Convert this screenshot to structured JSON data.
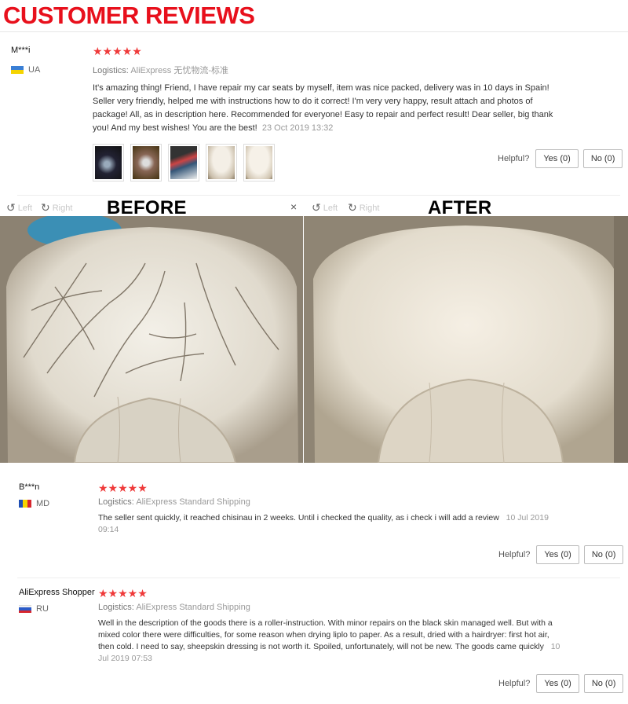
{
  "header": {
    "title": "CUSTOMER REVIEWS"
  },
  "colors": {
    "title": "#e8101c",
    "stars": "#ef3a3a"
  },
  "common": {
    "stars": "★★★★★",
    "helpful_label": "Helpful?",
    "logistics_label": "Logistics:"
  },
  "reviews": [
    {
      "user": "M***i",
      "country": "UA",
      "logistics": "AliExpress 无忧物流-标准",
      "text": "It's amazing thing! Friend, I have repair my car seats by myself, item was nice packed, delivery was in 10 days in Spain! Seller very friendly, helped me with instructions how to do it correct! I'm very very happy, result attach and photos of package! All, as in description here. Recommended for everyone! Easy to repair and perfect result! Dear seller, big thank you! And my best wishes! You are the best!",
      "date": "23 Oct 2019 13:32",
      "yes": "Yes (0)",
      "no": "No (0)"
    },
    {
      "user": "B***n",
      "country": "MD",
      "logistics": "AliExpress Standard Shipping",
      "text": "The seller sent quickly, it reached chisinau in 2 weeks. Until i checked the quality, as i check i will add a review",
      "date": "10 Jul 2019 09:14",
      "yes": "Yes (0)",
      "no": "No (0)"
    },
    {
      "user": "AliExpress Shopper",
      "country": "RU",
      "logistics": "AliExpress Standard Shipping",
      "text": "Well in the description of the goods there is a roller-instruction. With minor repairs on the black skin managed well. But with a mixed color there were difficulties, for some reason when drying liplo to paper. As a result, dried with a hairdryer: first hot air, then cold. I need to say, sheepskin dressing is not worth it. Spoiled, unfortunately, will not be new. The goods came quickly",
      "date": "10 Jul 2019 07:53",
      "yes": "Yes (0)",
      "no": "No (0)"
    }
  ],
  "viewer": {
    "before_label": "BEFORE",
    "after_label": "AFTER",
    "left": "Left",
    "right": "Right",
    "close": "×"
  }
}
